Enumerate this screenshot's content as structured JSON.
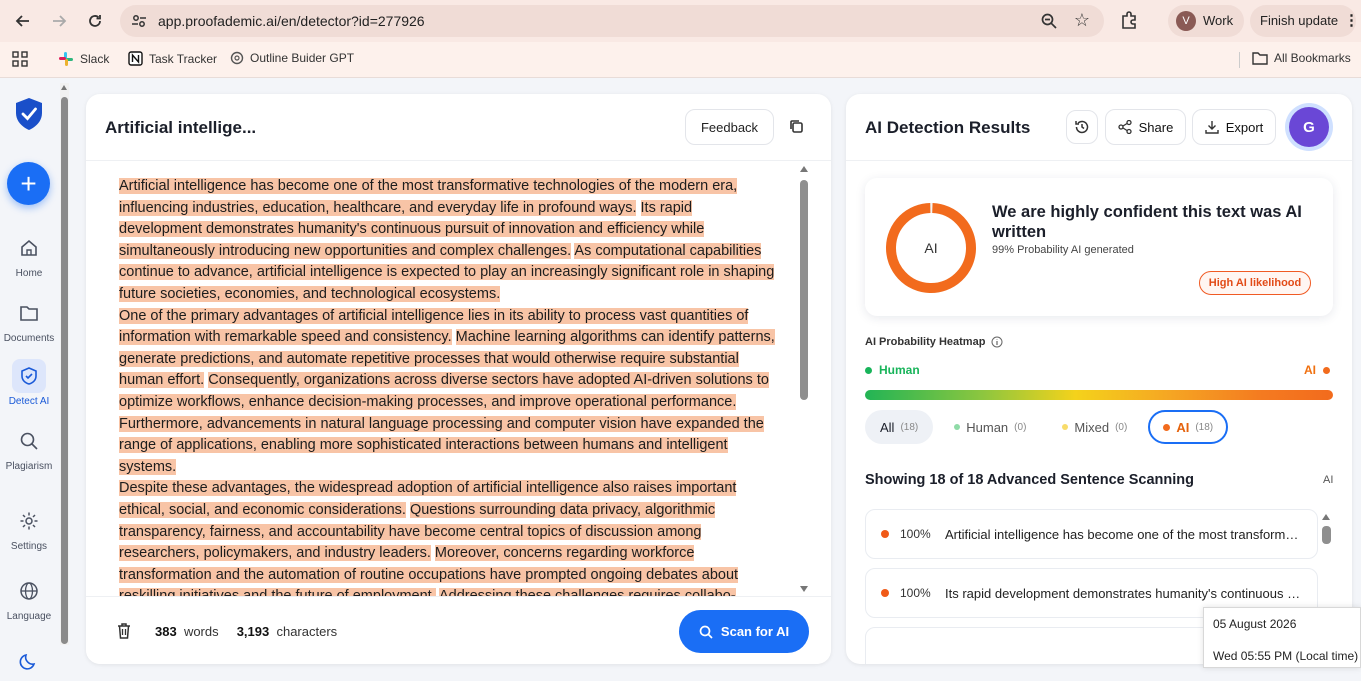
{
  "browser": {
    "url": "app.proofademic.ai/en/detector?id=277926",
    "profile_initial": "V",
    "profile_label": "Work",
    "update_label": "Finish update",
    "bookmarks": [
      "Slack",
      "Task Tracker",
      "Outline Buider GPT"
    ],
    "all_bookmarks": "All Bookmarks"
  },
  "sidebar": {
    "items": [
      {
        "label": "Home",
        "icon": "home-icon"
      },
      {
        "label": "Documents",
        "icon": "folder-icon"
      },
      {
        "label": "Detect AI",
        "icon": "shield-check-icon"
      },
      {
        "label": "Plagiarism",
        "icon": "search-icon"
      },
      {
        "label": "Settings",
        "icon": "gear-icon"
      },
      {
        "label": "Language",
        "icon": "globe-icon"
      }
    ]
  },
  "editor": {
    "title": "Artificial intellige...",
    "feedback_label": "Feedback",
    "paragraphs": [
      [
        "Artificial intelligence has become one of the most transformative technologies of the modern era, influencing industries, education, healthcare, and everyday life in profound ways.",
        "Its rapid development demonstrates humanity's continuous pursuit of innovation and efficiency while simultaneously introducing new opportunities and complex challenges.",
        "As computational capabilities continue to advance, artificial intelligence is expected to play an increasingly significant role in shaping future societies, economies, and technological ecosystems."
      ],
      [
        "One of the primary advantages of artificial intelligence lies in its ability to process vast quantities of information with remarkable speed and consistency.",
        "Machine learning algorithms can identify patterns, generate predictions, and automate repetitive processes that would otherwise require substantial human effort.",
        "Consequently, organizations across diverse sectors have adopted AI-driven solutions to optimize workflows, enhance decision-making processes, and improve operational performance.",
        "Furthermore, advancements in natural language processing and computer vision have expanded the range of applications, enabling more sophisticated interactions between humans and intelligent systems."
      ],
      [
        "Despite these advantages, the widespread adoption of artificial intelligence also raises important ethical, social, and economic considerations.",
        "Questions surrounding data privacy, algorithmic transparency, fairness, and accountability have become central topics of discussion among researchers, policymakers, and industry leaders.",
        "Moreover, concerns regarding workforce transformation and the automation of routine occupations have prompted ongoing debates about reskilling initiatives and the future of employment.",
        "Addressing these challenges requires collabo-"
      ]
    ],
    "word_count": "383",
    "word_unit": "words",
    "char_count": "3,193",
    "char_unit": "characters",
    "scan_label": "Scan for AI"
  },
  "results": {
    "title": "AI Detection Results",
    "share_label": "Share",
    "export_label": "Export",
    "avatar_initial": "G",
    "donut_label": "AI",
    "ai_probability": 0.99,
    "headline": "We are highly confident this text was AI written",
    "probability_text": "99% Probability AI generated",
    "badge": "High AI likelihood",
    "heatmap_title": "AI Probability Heatmap",
    "heatmap_human": "Human",
    "heatmap_ai": "AI",
    "tabs": [
      {
        "label": "All",
        "count": "(18)"
      },
      {
        "label": "Human",
        "count": "(0)"
      },
      {
        "label": "Mixed",
        "count": "(0)"
      },
      {
        "label": "AI",
        "count": "(18)"
      }
    ],
    "showing": "Showing 18 of 18 Advanced Sentence Scanning",
    "showing_tag": "AI",
    "sentences": [
      {
        "pct": "100%",
        "text": "Artificial intelligence has become one of the most transformative technologies of the modern era"
      },
      {
        "pct": "100%",
        "text": "Its rapid development demonstrates humanity's continuous pursuit of innovation"
      }
    ],
    "colors": {
      "human": "#18b45a",
      "mixed": "#f4d21b",
      "ai": "#f26b1d",
      "accent": "#1a6ef5"
    }
  },
  "clock": {
    "date": "05 August 2026",
    "time": "Wed 05:55 PM (Local time)"
  }
}
